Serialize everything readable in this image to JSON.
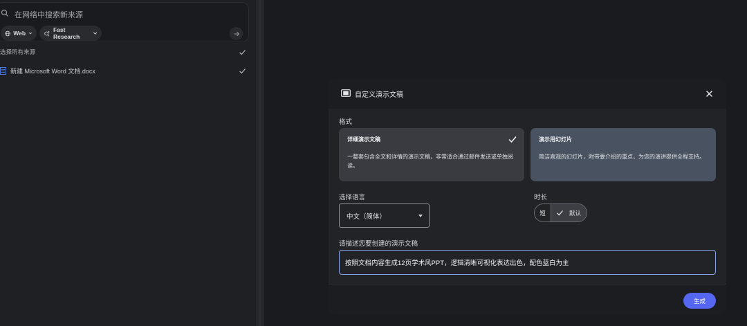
{
  "sources_panel": {
    "search": {
      "placeholder": "在网络中搜索新来源"
    },
    "chips": {
      "web": "Web",
      "research": "Fast Research"
    },
    "select_all_label": "选择所有来源",
    "sources": [
      {
        "name": "新建 Microsoft Word 文档.docx",
        "checked": true
      }
    ]
  },
  "dialog": {
    "title": "自定义演示文稿",
    "format": {
      "label": "格式",
      "options": [
        {
          "title": "详细演示文稿",
          "description": "一整套包含全文和详情的演示文稿，非常适合通过邮件发送或单独阅读。",
          "selected": true
        },
        {
          "title": "演示用幻灯片",
          "description": "简洁直观的幻灯片，附带要介绍的重点，为您的演讲提供全程支持。",
          "selected": false
        }
      ]
    },
    "language": {
      "label": "选择语言",
      "value": "中文（简体）"
    },
    "duration": {
      "label": "时长",
      "short": "短",
      "default": "默认",
      "selected": "默认"
    },
    "description": {
      "label": "请描述您要创建的演示文稿",
      "value": "按照文档内容生成12页学术风PPT，逻辑清晰可视化表达出色，配色蓝白为主"
    },
    "generate_label": "生成"
  },
  "colors": {
    "accent": "#5566f0",
    "card_selected": "#3a3b41",
    "card_unselected": "#485260",
    "input_focus": "#8aa6e6"
  },
  "icons": [
    "search-icon",
    "globe-icon",
    "research-icon",
    "chevron-down-icon",
    "arrow-right-icon",
    "check-icon",
    "document-icon",
    "slides-icon",
    "close-icon"
  ]
}
